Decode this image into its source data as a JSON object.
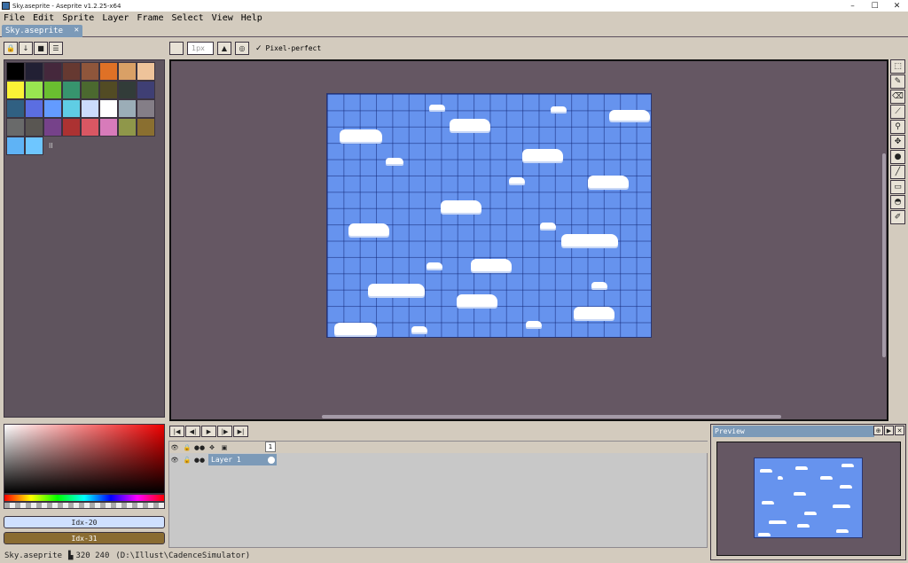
{
  "window": {
    "title": "Sky.aseprite - Aseprite v1.2.25-x64",
    "controls": [
      "–",
      "☐",
      "✕"
    ]
  },
  "menu": [
    "File",
    "Edit",
    "Sprite",
    "Layer",
    "Frame",
    "Select",
    "View",
    "Help"
  ],
  "tab": {
    "label": "Sky.aseprite",
    "close": "✕"
  },
  "palette_buttons": [
    "🔒",
    "↓",
    "■",
    "☰"
  ],
  "context_bar": {
    "brush_size": "1px",
    "pixel_perfect_check": "✓",
    "pixel_perfect_label": "Pixel-perfect"
  },
  "palette": {
    "colors": [
      "#000000",
      "#222034",
      "#45283c",
      "#663931",
      "#8f563b",
      "#df7126",
      "#d9a066",
      "#eec39a",
      "#fbf236",
      "#99e550",
      "#6abe30",
      "#37946e",
      "#4b692f",
      "#524b24",
      "#323c39",
      "#3f3f74",
      "#306082",
      "#5b6ee1",
      "#639bff",
      "#5fcde4",
      "#cbdbfc",
      "#ffffff",
      "#9badb7",
      "#847e87",
      "#696a6a",
      "#595652",
      "#76428a",
      "#ac3232",
      "#d95763",
      "#d77bba",
      "#8f974a",
      "#8a6f30",
      "#5fb3f5",
      "#6ec6ff"
    ],
    "more": "II"
  },
  "color_selector": {
    "fg_label": "Idx-20",
    "bg_label": "Idx-31"
  },
  "tools": [
    "⬚",
    "✎",
    "⌫",
    "⟋",
    "⚲",
    "✥",
    "●",
    "╱",
    "▭",
    "◓",
    "✐"
  ],
  "timeline": {
    "controls": [
      "|◀",
      "◀|",
      "▶",
      "|▶",
      "▶|"
    ],
    "header_icons": [
      "👁",
      "🔒",
      "●●",
      "✥",
      "▣"
    ],
    "frame_number": "1",
    "layers": [
      {
        "name": "Layer 1",
        "icons": [
          "👁",
          "🔓",
          "●●"
        ]
      }
    ]
  },
  "preview": {
    "title": "Preview",
    "controls": [
      "⊕",
      "▶",
      "✕"
    ]
  },
  "status": {
    "filename": "Sky.aseprite",
    "size_icon": "▙",
    "dimensions": "320 240",
    "path": "(D:\\Illust\\CadenceSimulator)"
  }
}
